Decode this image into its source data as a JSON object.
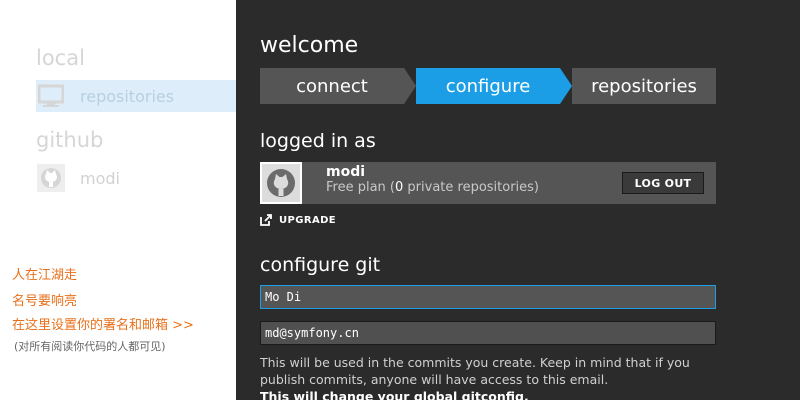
{
  "sidebar": {
    "local_heading": "local",
    "local_items": [
      {
        "label": "repositories",
        "icon": "computer-icon",
        "selected": true
      }
    ],
    "github_heading": "github",
    "github_items": [
      {
        "label": "modi",
        "icon": "github-octocat-icon"
      }
    ]
  },
  "note": {
    "line1": "人在江湖走",
    "line2": "名号要响亮",
    "line3": "在这里设置你的署名和邮箱 >>",
    "line4": "(对所有阅读你代码的人都可见)"
  },
  "main": {
    "title": "welcome",
    "steps": [
      {
        "label": "connect",
        "active": false
      },
      {
        "label": "configure",
        "active": true
      },
      {
        "label": "repositories",
        "active": false
      }
    ],
    "logged_in_heading": "logged in as",
    "user": {
      "name": "modi",
      "plan_prefix": "Free plan (",
      "private_count": "0",
      "plan_suffix": " private repositories)",
      "logout_label": "LOG OUT",
      "avatar_icon": "github-octocat-icon"
    },
    "upgrade_label": "UPGRADE",
    "upgrade_icon": "external-link-icon",
    "configure_heading": "configure git",
    "name_value": "Mo Di",
    "email_value": "md@symfony.cn",
    "help_text": "This will be used in the commits you create. Keep in mind that if you publish commits, anyone will have access to this email.",
    "help_strong": "This will change your global gitconfig."
  },
  "colors": {
    "accent": "#1c9ee6",
    "panel": "#2b2b2b",
    "tile": "#555555",
    "note": "#e8701a"
  }
}
